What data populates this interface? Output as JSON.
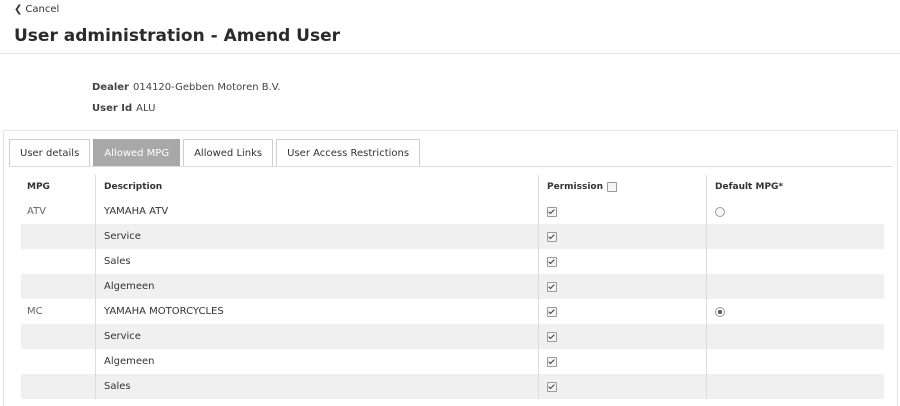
{
  "header": {
    "cancel_label": "Cancel",
    "title": "User administration - Amend User"
  },
  "info": {
    "dealer_label": "Dealer",
    "dealer_value": "014120-Gebben Motoren B.V.",
    "userid_label": "User Id",
    "userid_value": "ALU"
  },
  "tabs": [
    {
      "label": "User details",
      "active": false
    },
    {
      "label": "Allowed MPG",
      "active": true
    },
    {
      "label": "Allowed Links",
      "active": false
    },
    {
      "label": "User Access Restrictions",
      "active": false
    }
  ],
  "table": {
    "columns": {
      "mpg": "MPG",
      "description": "Description",
      "permission": "Permission",
      "default_mpg": "Default MPG*"
    },
    "permission_header_checked": false,
    "rows": [
      {
        "mpg": "ATV",
        "description": "YAMAHA ATV",
        "permission": true,
        "default": "unchecked"
      },
      {
        "mpg": "",
        "description": "Service",
        "permission": true,
        "default": "none"
      },
      {
        "mpg": "",
        "description": "Sales",
        "permission": true,
        "default": "none"
      },
      {
        "mpg": "",
        "description": "Algemeen",
        "permission": true,
        "default": "none"
      },
      {
        "mpg": "MC",
        "description": "YAMAHA MOTORCYCLES",
        "permission": true,
        "default": "checked"
      },
      {
        "mpg": "",
        "description": "Service",
        "permission": true,
        "default": "none"
      },
      {
        "mpg": "",
        "description": "Algemeen",
        "permission": true,
        "default": "none"
      },
      {
        "mpg": "",
        "description": "Sales",
        "permission": true,
        "default": "none"
      }
    ]
  },
  "colors": {
    "active_tab_bg": "#a8a8a8",
    "row_shade": "#f0f0f0",
    "border": "#dcdcdc"
  }
}
